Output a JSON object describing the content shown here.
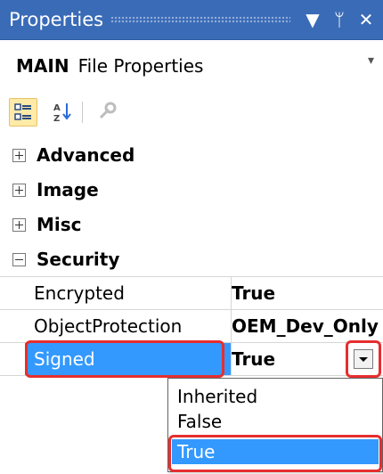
{
  "window": {
    "title": "Properties",
    "dropdown_glyph": "▼",
    "pin_glyph": "ᛘ",
    "close_glyph": "✕"
  },
  "object_selector": {
    "name": "MAIN",
    "type": "File Properties",
    "dropdown_glyph": "▾"
  },
  "toolbar": {
    "icons": [
      "categorized-icon",
      "alphabetical-icon",
      "property-pages-icon"
    ]
  },
  "categories": [
    {
      "label": "Advanced",
      "expanded": false
    },
    {
      "label": "Image",
      "expanded": false
    },
    {
      "label": "Misc",
      "expanded": false
    },
    {
      "label": "Security",
      "expanded": true
    }
  ],
  "properties": [
    {
      "name": "Encrypted",
      "value": "True"
    },
    {
      "name": "ObjectProtection",
      "value": "OEM_Dev_Only"
    },
    {
      "name": "Signed",
      "value": "True",
      "selected": true
    }
  ],
  "dropdown": {
    "options": [
      "Inherited",
      "False",
      "True"
    ],
    "selected_index": 2
  },
  "colors": {
    "title_bar": "#3a6bb7",
    "selection": "#3399ff",
    "highlight": "#e62e2e"
  }
}
